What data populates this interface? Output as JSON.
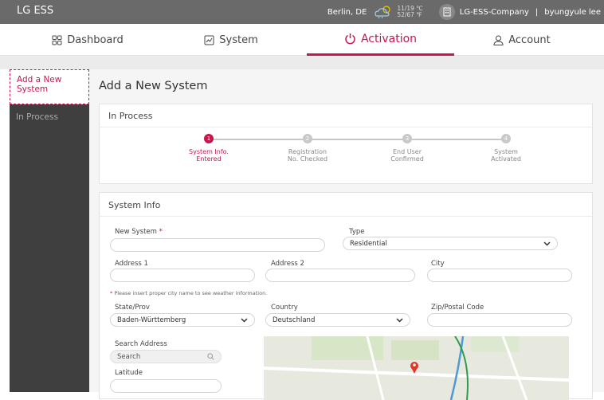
{
  "topbar": {
    "brand": "LG ESS",
    "location": "Berlin, DE",
    "temp_c": "11/19 ℃",
    "temp_f": "52/67 ℉",
    "company": "LG-ESS-Company",
    "separator": "|",
    "user": "byungyule lee",
    "weather_icon": "partly-cloudy-rain-icon",
    "company_icon": "building-icon"
  },
  "nav": {
    "tabs": [
      {
        "label": "Dashboard",
        "icon": "grid-icon"
      },
      {
        "label": "System",
        "icon": "chart-icon"
      },
      {
        "label": "Activation",
        "icon": "power-icon",
        "active": true
      },
      {
        "label": "Account",
        "icon": "user-icon"
      }
    ]
  },
  "sidebar": {
    "items": [
      {
        "label": "Add a New System",
        "active": true
      },
      {
        "label": "In Process"
      }
    ]
  },
  "main": {
    "title": "Add a New System",
    "process_card": {
      "title": "In Process",
      "steps": [
        {
          "num": "1",
          "label1": "System Info.",
          "label2": "Entered",
          "active": true
        },
        {
          "num": "2",
          "label1": "Registration",
          "label2": "No. Checked"
        },
        {
          "num": "3",
          "label1": "End User",
          "label2": "Confirmed"
        },
        {
          "num": "4",
          "label1": "System",
          "label2": "Activated"
        }
      ]
    },
    "info_card": {
      "title": "System Info",
      "new_system_label": "New System",
      "required_mark": "*",
      "type_label": "Type",
      "type_value": "Residential",
      "address1_label": "Address 1",
      "address2_label": "Address 2",
      "city_label": "City",
      "note_mark": "*",
      "note": "Please insert proper city name to see weather information.",
      "state_label": "State/Prov",
      "state_value": "Baden-Württemberg",
      "country_label": "Country",
      "country_value": "Deutschland",
      "zip_label": "Zip/Postal Code",
      "search_label": "Search Address",
      "search_placeholder": "Search",
      "latitude_label": "Latitude"
    }
  },
  "colors": {
    "accent": "#c5174e",
    "topbar": "#6a6a6a",
    "sidebar": "#3f3f3f"
  }
}
